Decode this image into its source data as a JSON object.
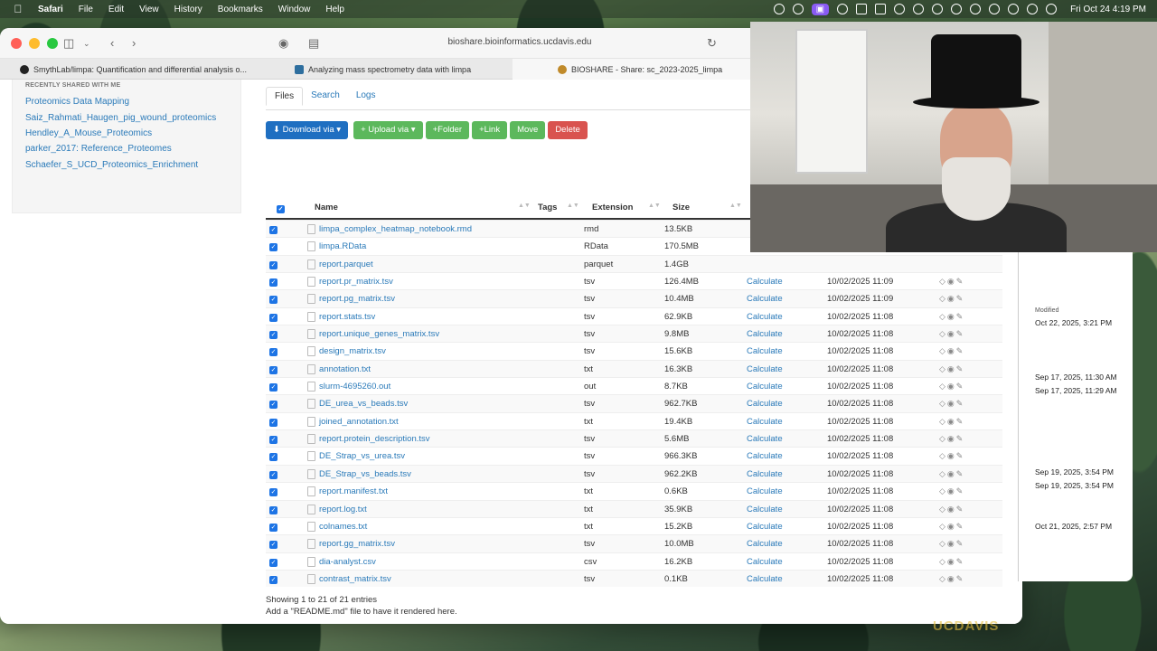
{
  "menubar": {
    "app": "Safari",
    "items": [
      "File",
      "Edit",
      "View",
      "History",
      "Bookmarks",
      "Window",
      "Help"
    ],
    "datetime": "Fri Oct 24  4:19 PM"
  },
  "browser": {
    "address": "bioshare.bioinformatics.ucdavis.edu",
    "tabs": [
      "SmythLab/limpa: Quantification and differential analysis o...",
      "Analyzing mass spectrometry data with limpa",
      "BIOSHARE - Share: sc_2023-2025_limpa"
    ]
  },
  "sidebar": {
    "heading": "RECENTLY SHARED WITH ME",
    "links": [
      "Proteomics Data Mapping",
      "Saiz_Rahmati_Haugen_pig_wound_proteomics",
      "Hendley_A_Mouse_Proteomics",
      "parker_2017: Reference_Proteomes",
      "Schaefer_S_UCD_Proteomics_Enrichment"
    ]
  },
  "navtabs": [
    "Files",
    "Search",
    "Logs"
  ],
  "actions": {
    "download": "Download via",
    "upload": "Upload via",
    "folder": "Folder",
    "link": "Link",
    "move": "Move",
    "delete": "Delete"
  },
  "table": {
    "headers": {
      "name": "Name",
      "tags": "Tags",
      "extension": "Extension",
      "size": "Size"
    },
    "rows": [
      {
        "name": "limpa_complex_heatmap_notebook.rmd",
        "ext": "rmd",
        "size": "13.5KB",
        "calc": "",
        "date": ""
      },
      {
        "name": "limpa.RData",
        "ext": "RData",
        "size": "170.5MB",
        "calc": "",
        "date": ""
      },
      {
        "name": "report.parquet",
        "ext": "parquet",
        "size": "1.4GB",
        "calc": "",
        "date": ""
      },
      {
        "name": "report.pr_matrix.tsv",
        "ext": "tsv",
        "size": "126.4MB",
        "calc": "Calculate",
        "date": "10/02/2025 11:09"
      },
      {
        "name": "report.pg_matrix.tsv",
        "ext": "tsv",
        "size": "10.4MB",
        "calc": "Calculate",
        "date": "10/02/2025 11:09"
      },
      {
        "name": "report.stats.tsv",
        "ext": "tsv",
        "size": "62.9KB",
        "calc": "Calculate",
        "date": "10/02/2025 11:08"
      },
      {
        "name": "report.unique_genes_matrix.tsv",
        "ext": "tsv",
        "size": "9.8MB",
        "calc": "Calculate",
        "date": "10/02/2025 11:08"
      },
      {
        "name": "design_matrix.tsv",
        "ext": "tsv",
        "size": "15.6KB",
        "calc": "Calculate",
        "date": "10/02/2025 11:08"
      },
      {
        "name": "annotation.txt",
        "ext": "txt",
        "size": "16.3KB",
        "calc": "Calculate",
        "date": "10/02/2025 11:08"
      },
      {
        "name": "slurm-4695260.out",
        "ext": "out",
        "size": "8.7KB",
        "calc": "Calculate",
        "date": "10/02/2025 11:08"
      },
      {
        "name": "DE_urea_vs_beads.tsv",
        "ext": "tsv",
        "size": "962.7KB",
        "calc": "Calculate",
        "date": "10/02/2025 11:08"
      },
      {
        "name": "joined_annotation.txt",
        "ext": "txt",
        "size": "19.4KB",
        "calc": "Calculate",
        "date": "10/02/2025 11:08"
      },
      {
        "name": "report.protein_description.tsv",
        "ext": "tsv",
        "size": "5.6MB",
        "calc": "Calculate",
        "date": "10/02/2025 11:08"
      },
      {
        "name": "DE_Strap_vs_urea.tsv",
        "ext": "tsv",
        "size": "966.3KB",
        "calc": "Calculate",
        "date": "10/02/2025 11:08"
      },
      {
        "name": "DE_Strap_vs_beads.tsv",
        "ext": "tsv",
        "size": "962.2KB",
        "calc": "Calculate",
        "date": "10/02/2025 11:08"
      },
      {
        "name": "report.manifest.txt",
        "ext": "txt",
        "size": "0.6KB",
        "calc": "Calculate",
        "date": "10/02/2025 11:08"
      },
      {
        "name": "report.log.txt",
        "ext": "txt",
        "size": "35.9KB",
        "calc": "Calculate",
        "date": "10/02/2025 11:08"
      },
      {
        "name": "colnames.txt",
        "ext": "txt",
        "size": "15.2KB",
        "calc": "Calculate",
        "date": "10/02/2025 11:08"
      },
      {
        "name": "report.gg_matrix.tsv",
        "ext": "tsv",
        "size": "10.0MB",
        "calc": "Calculate",
        "date": "10/02/2025 11:08"
      },
      {
        "name": "dia-analyst.csv",
        "ext": "csv",
        "size": "16.2KB",
        "calc": "Calculate",
        "date": "10/02/2025 11:08"
      },
      {
        "name": "contrast_matrix.tsv",
        "ext": "tsv",
        "size": "0.1KB",
        "calc": "Calculate",
        "date": "10/02/2025 11:08"
      }
    ],
    "footer": "Showing 1 to 21 of 21 entries",
    "readme": "Add a \"README.md\" file to have it rendered here."
  },
  "finder": {
    "header": "Modified",
    "dates": [
      "Oct 22, 2025, 3:21 PM",
      "Sep 17, 2025, 11:30 AM",
      "Sep 17, 2025, 11:29 AM",
      "Sep 19, 2025, 3:54 PM",
      "Sep 19, 2025, 3:54 PM",
      "Oct 21, 2025, 2:57 PM"
    ]
  },
  "watermark": "UCDAVIS",
  "colors": {
    "link": "#2a7ab9",
    "primary": "#1f6fc1",
    "success": "#5cb85c",
    "danger": "#d9534f"
  }
}
